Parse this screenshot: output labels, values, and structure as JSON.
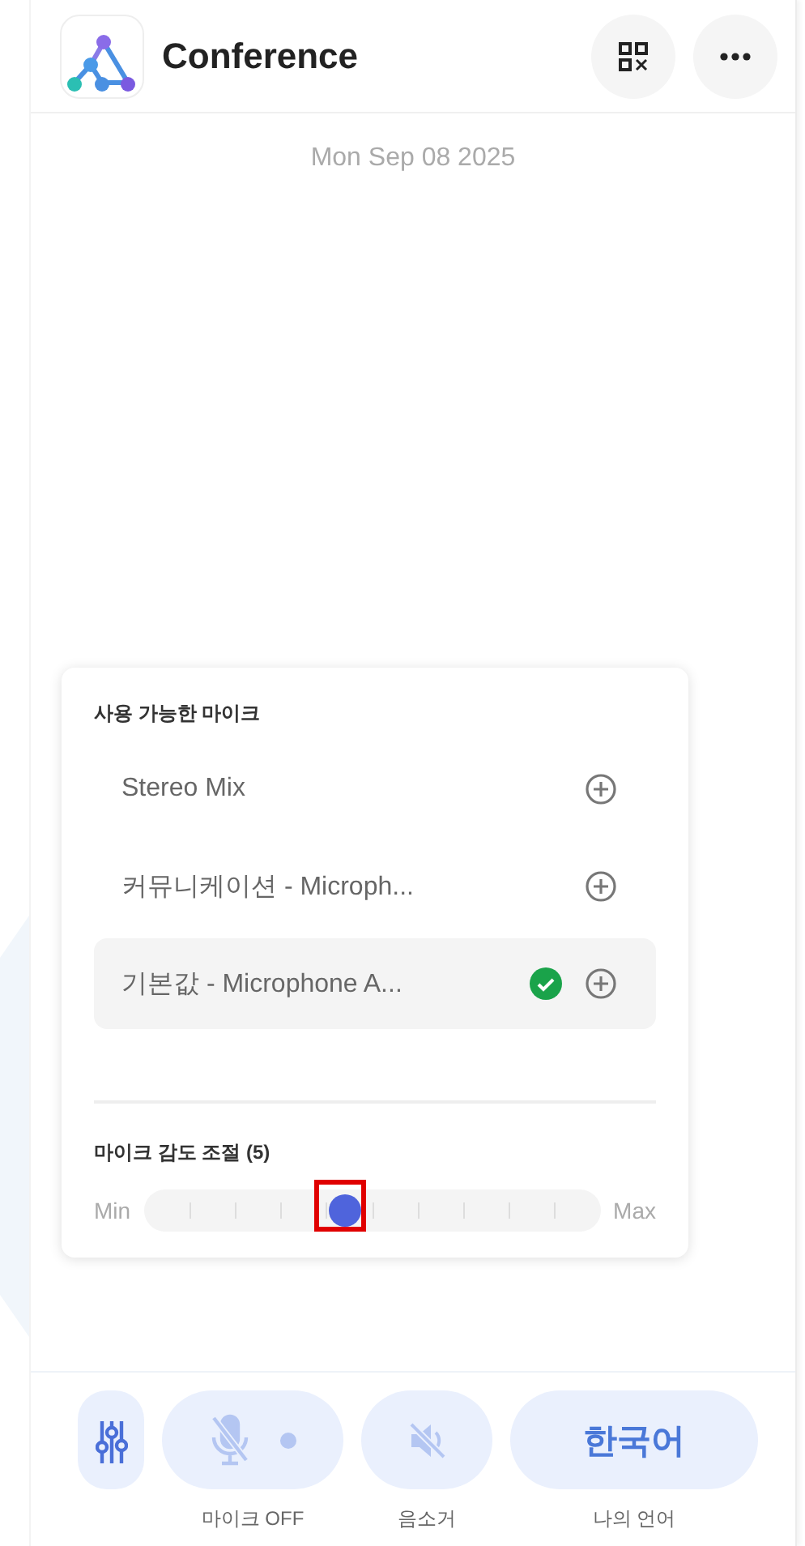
{
  "header": {
    "title": "Conference"
  },
  "date": "Mon Sep 08 2025",
  "mic_panel": {
    "heading": "사용 가능한 마이크",
    "devices": [
      {
        "name": "Stereo Mix",
        "selected": false
      },
      {
        "name": "커뮤니케이션 - Microph...",
        "selected": false
      },
      {
        "name": "기본값 - Microphone A...",
        "selected": true
      }
    ],
    "sensitivity": {
      "label": "마이크 감도 조절 (5)",
      "min": "Min",
      "max": "Max",
      "level": 0.44
    }
  },
  "bottom_bar": {
    "mic": {
      "label": "마이크 OFF",
      "on": false
    },
    "mute": {
      "label": "음소거"
    },
    "language": {
      "value": "한국어",
      "label": "나의 언어"
    }
  }
}
